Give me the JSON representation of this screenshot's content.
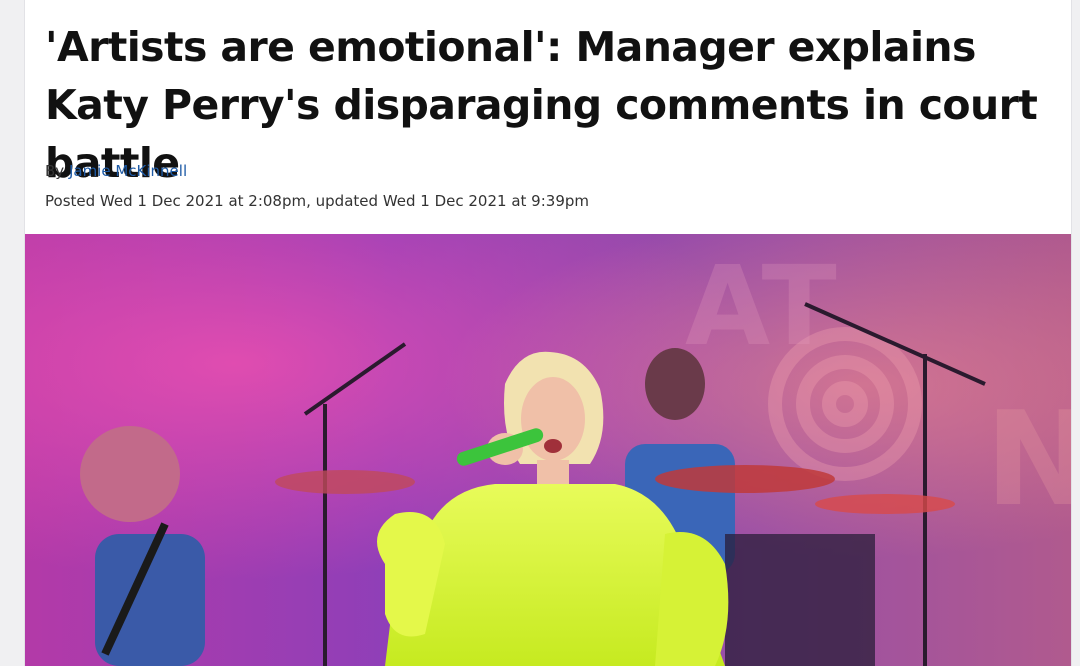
{
  "article": {
    "headline": "'Artists are emotional': Manager explains Katy Perry's disparaging comments in court battle",
    "byline_prefix": "By",
    "author": "Jamie McKinnell",
    "posted_label": "Posted",
    "posted_date": "Wed 1 Dec 2021 at 2:08pm",
    "updated_label": ", updated",
    "updated_date": "Wed 1 Dec 2021 at 9:39pm"
  },
  "hero_image": {
    "description_icon": "concert-photo",
    "colors": {
      "backdrop": "#7a2fa8",
      "haze": "#e0479a",
      "dress": "#d9f23a",
      "microphone": "#3cc43c"
    }
  }
}
